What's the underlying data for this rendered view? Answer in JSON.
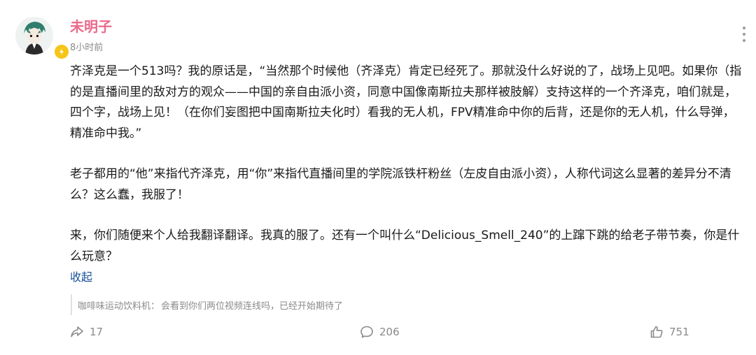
{
  "post": {
    "author": "未明子",
    "time": "8小时前",
    "paragraphs": [
      "齐泽克是一个513吗？我的原话是，“当然那个时候他（齐泽克）肯定已经死了。那就没什么好说的了，战场上见吧。如果你（指的是直播间里的敌对方的观众——中国的亲自由派小资，同意中国像南斯拉夫那样被肢解）支持这样的一个齐泽克，咱们就是，四个字，战场上见！（在你们妄图把中国南斯拉夫化时）看我的无人机，FPV精准命中你的后背，还是你的无人机，什么导弹，精准命中我。”",
      "老子都用的“他”来指代齐泽克，用“你”来指代直播间里的学院派铁杆粉丝（左皮自由派小资），人称代词这么显著的差异分不清么？这么蠢，我服了！",
      "来，你们随便来个人给我翻译翻译。我真的服了。还有一个叫什么“Delicious_Smell_240”的上蹿下跳的给老子带节奏，你是什么玩意？"
    ],
    "collapse_label": "收起"
  },
  "quote": {
    "author": "咖啡味运动饮料机：",
    "text": "会看到你们两位视频连线吗，已经开始期待了"
  },
  "actions": {
    "share_count": "17",
    "comment_count": "206",
    "like_count": "751"
  },
  "colors": {
    "author": "#eb6a8b",
    "link": "#175199",
    "muted": "#8a8a8a",
    "badge": "#f5c518"
  },
  "icons": [
    "avatar",
    "verified-badge-icon",
    "more-options-icon",
    "share-icon",
    "comment-icon",
    "like-icon"
  ]
}
